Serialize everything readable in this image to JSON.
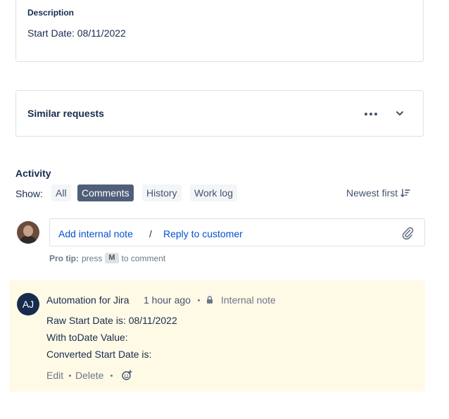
{
  "description": {
    "label": "Description",
    "text": "Start Date: 08/11/2022"
  },
  "similar_requests": {
    "title": "Similar requests",
    "more_icon": "more-horizontal-icon",
    "expand_icon": "chevron-down-icon"
  },
  "activity": {
    "title": "Activity",
    "show_label": "Show:",
    "filters": [
      "All",
      "Comments",
      "History",
      "Work log"
    ],
    "active_filter": "Comments",
    "sort_label": "Newest first",
    "sort_icon": "sort-descending-icon"
  },
  "comment_box": {
    "add_internal_note": "Add internal note",
    "separator": "/",
    "reply_to_customer": "Reply to customer",
    "attach_icon": "paperclip-icon"
  },
  "pro_tip": {
    "label": "Pro tip:",
    "press": "press",
    "key": "M",
    "suffix": "to comment"
  },
  "note": {
    "avatar_initials": "AJ",
    "author": "Automation for Jira",
    "time": "1 hour ago",
    "lock_icon": "lock-icon",
    "type": "Internal note",
    "lines": [
      "Raw Start Date is: 08/11/2022",
      "With toDate Value:",
      "Converted Start Date is:"
    ],
    "actions": {
      "edit": "Edit",
      "delete": "Delete",
      "reaction_icon": "add-reaction-icon"
    }
  },
  "colors": {
    "link": "#0052cc",
    "active_filter_bg": "#505f79",
    "note_bg": "#fffae6"
  }
}
